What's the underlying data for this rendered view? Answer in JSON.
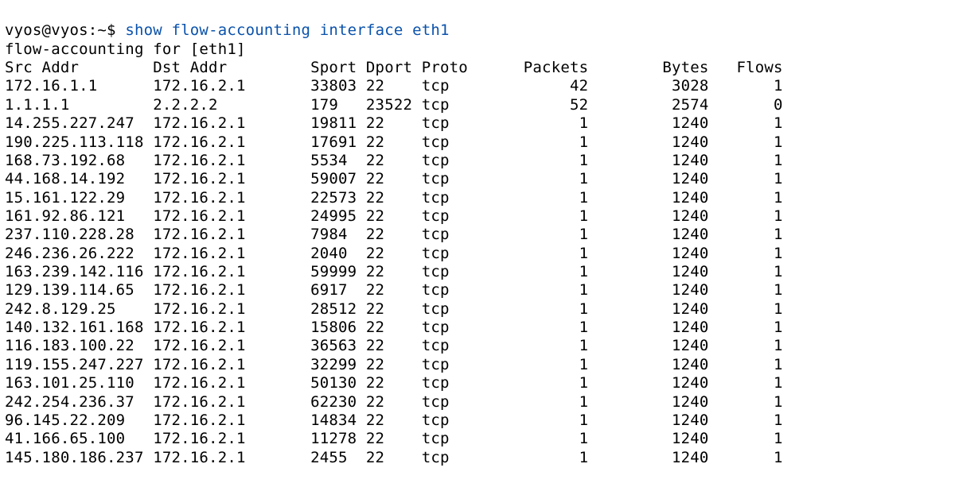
{
  "prompt": "vyos@vyos:~$ ",
  "command": "show flow-accounting interface eth1",
  "banner": "flow-accounting for [eth1]",
  "header": [
    "Src Addr",
    "Dst Addr",
    "Sport",
    "Dport",
    "Proto",
    "Packets",
    "Bytes",
    "Flows"
  ],
  "rows": [
    {
      "src": "172.16.1.1",
      "dst": "172.16.2.1",
      "sport": "33803",
      "dport": "22",
      "proto": "tcp",
      "packets": "42",
      "bytes": "3028",
      "flows": "1"
    },
    {
      "src": "1.1.1.1",
      "dst": "2.2.2.2",
      "sport": "179",
      "dport": "23522",
      "proto": "tcp",
      "packets": "52",
      "bytes": "2574",
      "flows": "0"
    },
    {
      "src": "14.255.227.247",
      "dst": "172.16.2.1",
      "sport": "19811",
      "dport": "22",
      "proto": "tcp",
      "packets": "1",
      "bytes": "1240",
      "flows": "1"
    },
    {
      "src": "190.225.113.118",
      "dst": "172.16.2.1",
      "sport": "17691",
      "dport": "22",
      "proto": "tcp",
      "packets": "1",
      "bytes": "1240",
      "flows": "1"
    },
    {
      "src": "168.73.192.68",
      "dst": "172.16.2.1",
      "sport": "5534",
      "dport": "22",
      "proto": "tcp",
      "packets": "1",
      "bytes": "1240",
      "flows": "1"
    },
    {
      "src": "44.168.14.192",
      "dst": "172.16.2.1",
      "sport": "59007",
      "dport": "22",
      "proto": "tcp",
      "packets": "1",
      "bytes": "1240",
      "flows": "1"
    },
    {
      "src": "15.161.122.29",
      "dst": "172.16.2.1",
      "sport": "22573",
      "dport": "22",
      "proto": "tcp",
      "packets": "1",
      "bytes": "1240",
      "flows": "1"
    },
    {
      "src": "161.92.86.121",
      "dst": "172.16.2.1",
      "sport": "24995",
      "dport": "22",
      "proto": "tcp",
      "packets": "1",
      "bytes": "1240",
      "flows": "1"
    },
    {
      "src": "237.110.228.28",
      "dst": "172.16.2.1",
      "sport": "7984",
      "dport": "22",
      "proto": "tcp",
      "packets": "1",
      "bytes": "1240",
      "flows": "1"
    },
    {
      "src": "246.236.26.222",
      "dst": "172.16.2.1",
      "sport": "2040",
      "dport": "22",
      "proto": "tcp",
      "packets": "1",
      "bytes": "1240",
      "flows": "1"
    },
    {
      "src": "163.239.142.116",
      "dst": "172.16.2.1",
      "sport": "59999",
      "dport": "22",
      "proto": "tcp",
      "packets": "1",
      "bytes": "1240",
      "flows": "1"
    },
    {
      "src": "129.139.114.65",
      "dst": "172.16.2.1",
      "sport": "6917",
      "dport": "22",
      "proto": "tcp",
      "packets": "1",
      "bytes": "1240",
      "flows": "1"
    },
    {
      "src": "242.8.129.25",
      "dst": "172.16.2.1",
      "sport": "28512",
      "dport": "22",
      "proto": "tcp",
      "packets": "1",
      "bytes": "1240",
      "flows": "1"
    },
    {
      "src": "140.132.161.168",
      "dst": "172.16.2.1",
      "sport": "15806",
      "dport": "22",
      "proto": "tcp",
      "packets": "1",
      "bytes": "1240",
      "flows": "1"
    },
    {
      "src": "116.183.100.22",
      "dst": "172.16.2.1",
      "sport": "36563",
      "dport": "22",
      "proto": "tcp",
      "packets": "1",
      "bytes": "1240",
      "flows": "1"
    },
    {
      "src": "119.155.247.227",
      "dst": "172.16.2.1",
      "sport": "32299",
      "dport": "22",
      "proto": "tcp",
      "packets": "1",
      "bytes": "1240",
      "flows": "1"
    },
    {
      "src": "163.101.25.110",
      "dst": "172.16.2.1",
      "sport": "50130",
      "dport": "22",
      "proto": "tcp",
      "packets": "1",
      "bytes": "1240",
      "flows": "1"
    },
    {
      "src": "242.254.236.37",
      "dst": "172.16.2.1",
      "sport": "62230",
      "dport": "22",
      "proto": "tcp",
      "packets": "1",
      "bytes": "1240",
      "flows": "1"
    },
    {
      "src": "96.145.22.209",
      "dst": "172.16.2.1",
      "sport": "14834",
      "dport": "22",
      "proto": "tcp",
      "packets": "1",
      "bytes": "1240",
      "flows": "1"
    },
    {
      "src": "41.166.65.100",
      "dst": "172.16.2.1",
      "sport": "11278",
      "dport": "22",
      "proto": "tcp",
      "packets": "1",
      "bytes": "1240",
      "flows": "1"
    },
    {
      "src": "145.180.186.237",
      "dst": "172.16.2.1",
      "sport": "2455",
      "dport": "22",
      "proto": "tcp",
      "packets": "1",
      "bytes": "1240",
      "flows": "1"
    }
  ],
  "col_widths": {
    "src": 16,
    "dst": 17,
    "sport": 6,
    "dport": 6,
    "proto": 6,
    "packets": 12,
    "bytes": 13,
    "flows": 8
  }
}
